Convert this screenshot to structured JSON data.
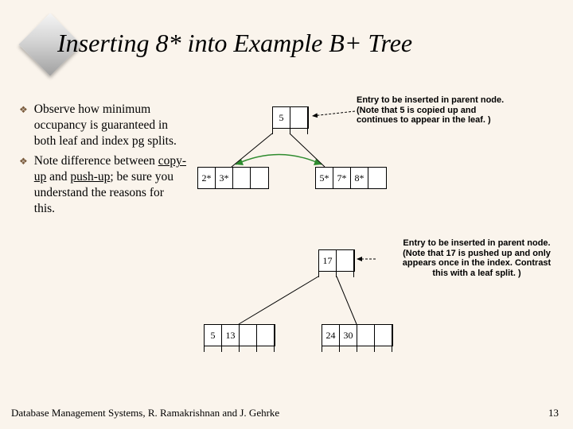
{
  "title": "Inserting 8* into Example B+ Tree",
  "bullets": [
    {
      "pre": "Observe how minimum occupancy is guaranteed in both leaf and index pg splits."
    },
    {
      "pre": "Note difference between ",
      "u1": "copy-up",
      "mid": " and ",
      "u2": "push-up",
      "post": "; be sure you understand the reasons for this."
    }
  ],
  "ann1": {
    "l1": "Entry to be inserted in parent node.",
    "l2": "(Note that 5 is copied up and",
    "l3": "continues to appear in the leaf. )"
  },
  "ann2": {
    "l1": "Entry to be inserted in parent node.",
    "l2": "(Note that 17 is pushed up and only",
    "l3": "appears once in the index. Contrast",
    "l4": "this with a leaf split. )"
  },
  "top_node": [
    "5",
    "",
    "",
    ""
  ],
  "leaf_left": [
    "2*",
    "3*",
    "",
    ""
  ],
  "leaf_right": [
    "5*",
    "7*",
    "8*",
    ""
  ],
  "mid_node": [
    "17",
    "",
    "",
    ""
  ],
  "bot_left": [
    "5",
    "13",
    "",
    ""
  ],
  "bot_right": [
    "24",
    "30",
    "",
    ""
  ],
  "footer": "Database Management Systems, R. Ramakrishnan and J. Gehrke",
  "page": "13"
}
